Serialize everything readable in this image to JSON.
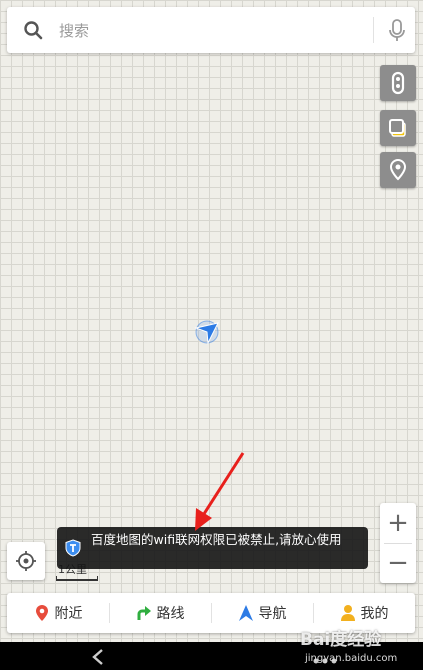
{
  "search": {
    "placeholder": "搜索"
  },
  "side_buttons": [
    {
      "icon": "traffic-light-icon"
    },
    {
      "icon": "layers-icon"
    },
    {
      "icon": "map-pin-icon"
    }
  ],
  "zoom": {
    "in_label": "+",
    "out_label": "−"
  },
  "scale": {
    "label": "1公里"
  },
  "toast": {
    "icon": "shield-icon",
    "message": "百度地图的wifi联网权限已被禁止,请放心使用"
  },
  "bottom_nav": [
    {
      "label": "附近",
      "icon": "nearby-pin-icon",
      "color": "#e74c3c"
    },
    {
      "label": "路线",
      "icon": "route-arrow-icon",
      "color": "#2fae3f"
    },
    {
      "label": "导航",
      "icon": "navigation-arrow-icon",
      "color": "#2d7be5"
    },
    {
      "label": "我的",
      "icon": "user-icon",
      "color": "#f2b01e"
    }
  ],
  "watermark": {
    "brand": "Bai度经验",
    "url": "jingyan.baidu.com"
  },
  "colors": {
    "accent": "#2d7be5",
    "arrow": "#e8201c",
    "side_button": "#8d8d8d"
  }
}
